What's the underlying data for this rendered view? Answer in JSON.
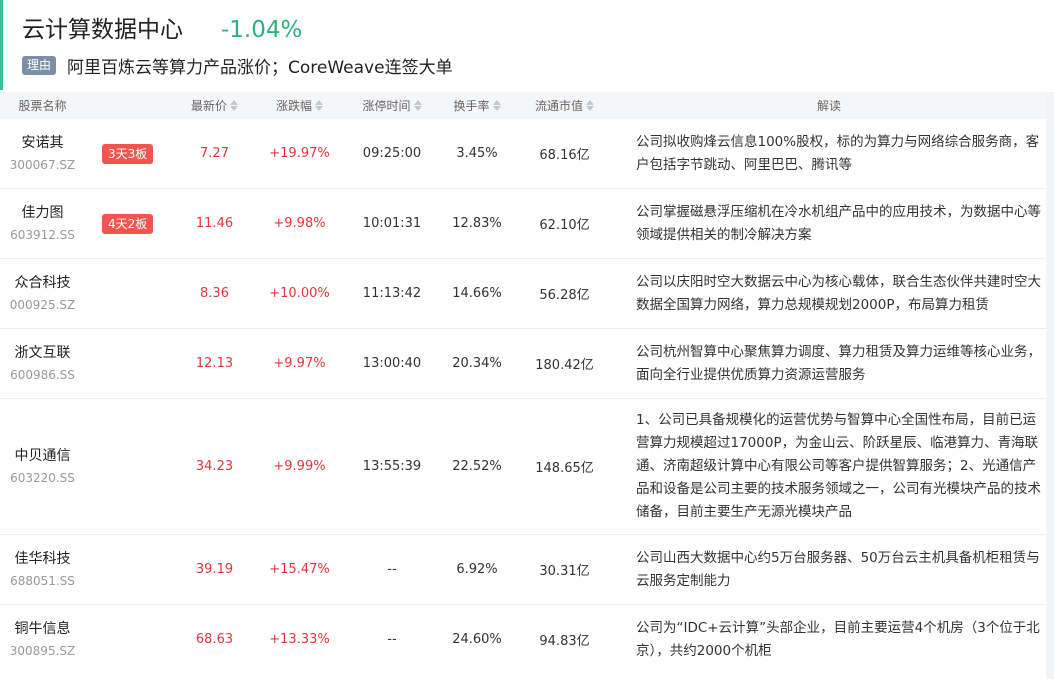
{
  "header": {
    "sector_name": "云计算数据中心",
    "sector_change": "-1.04%",
    "reason_tag": "理由",
    "reason_text": "阿里百炼云等算力产品涨价；CoreWeave连签大单"
  },
  "columns": {
    "name": "股票名称",
    "price": "最新价",
    "change": "涨跌幅",
    "limit_time": "涨停时间",
    "turnover": "换手率",
    "market_cap": "流通市值",
    "desc": "解读"
  },
  "rows": [
    {
      "name": "安诺其",
      "code": "300067.SZ",
      "badge": "3天3板",
      "price": "7.27",
      "change": "+19.97%",
      "time": "09:25:00",
      "turnover": "3.45%",
      "cap": "68.16亿",
      "desc": "公司拟收购烽云信息100%股权，标的为算力与网络综合服务商，客户包括字节跳动、阿里巴巴、腾讯等"
    },
    {
      "name": "佳力图",
      "code": "603912.SS",
      "badge": "4天2板",
      "price": "11.46",
      "change": "+9.98%",
      "time": "10:01:31",
      "turnover": "12.83%",
      "cap": "62.10亿",
      "desc": "公司掌握磁悬浮压缩机在冷水机组产品中的应用技术，为数据中心等领域提供相关的制冷解决方案"
    },
    {
      "name": "众合科技",
      "code": "000925.SZ",
      "badge": "",
      "price": "8.36",
      "change": "+10.00%",
      "time": "11:13:42",
      "turnover": "14.66%",
      "cap": "56.28亿",
      "desc": "公司以庆阳时空大数据云中心为核心载体，联合生态伙伴共建时空大数据全国算力网络，算力总规模规划2000P，布局算力租赁"
    },
    {
      "name": "浙文互联",
      "code": "600986.SS",
      "badge": "",
      "price": "12.13",
      "change": "+9.97%",
      "time": "13:00:40",
      "turnover": "20.34%",
      "cap": "180.42亿",
      "desc": "公司杭州智算中心聚焦算力调度、算力租赁及算力运维等核心业务，面向全行业提供优质算力资源运营服务"
    },
    {
      "name": "中贝通信",
      "code": "603220.SS",
      "badge": "",
      "price": "34.23",
      "change": "+9.99%",
      "time": "13:55:39",
      "turnover": "22.52%",
      "cap": "148.65亿",
      "desc": "1、公司已具备规模化的运营优势与智算中心全国性布局，目前已运营算力规模超过17000P，为金山云、阶跃星辰、临港算力、青海联通、济南超级计算中心有限公司等客户提供智算服务；2、光通信产品和设备是公司主要的技术服务领域之一，公司有光模块产品的技术储备，目前主要生产无源光模块产品"
    },
    {
      "name": "佳华科技",
      "code": "688051.SS",
      "badge": "",
      "price": "39.19",
      "change": "+15.47%",
      "time": "--",
      "turnover": "6.92%",
      "cap": "30.31亿",
      "desc": "公司山西大数据中心约5万台服务器、50万台云主机具备机柜租赁与云服务定制能力"
    },
    {
      "name": "铜牛信息",
      "code": "300895.SZ",
      "badge": "",
      "price": "68.63",
      "change": "+13.33%",
      "time": "--",
      "turnover": "24.60%",
      "cap": "94.83亿",
      "desc": "公司为“IDC+云计算”头部企业，目前主要运营4个机房（3个位于北京），共约2000个机柜"
    }
  ]
}
